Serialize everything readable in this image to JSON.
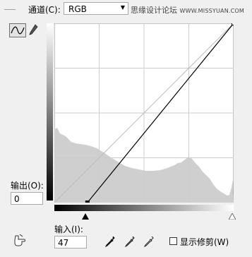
{
  "channel": {
    "label": "通道(C):",
    "value": "RGB"
  },
  "watermark": {
    "cn": "思缘设计论坛",
    "url": "WWW.MISSYUAN.COM"
  },
  "output": {
    "label": "输出(O):",
    "value": "0"
  },
  "input": {
    "label": "输入(I):",
    "value": "47"
  },
  "show_clipping": {
    "label": "显示修剪(W)",
    "checked": false
  },
  "curve": {
    "points": [
      {
        "input": 47,
        "output": 0
      },
      {
        "input": 255,
        "output": 255
      }
    ],
    "range": [
      0,
      255
    ]
  },
  "tools": {
    "curve_tool": "curve-icon",
    "pencil_tool": "pencil-icon",
    "target_adjust": "hand-icon",
    "eyedroppers": [
      "black-eyedropper-icon",
      "gray-eyedropper-icon",
      "white-eyedropper-icon"
    ]
  },
  "colors": {
    "histogram": "#cfcfcf",
    "curve": "#000000",
    "baseline": "#bdbdbd",
    "panel": "#f0f0f0"
  }
}
